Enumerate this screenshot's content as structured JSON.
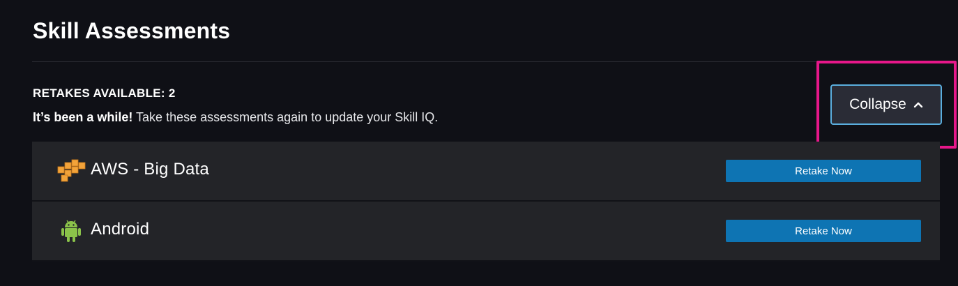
{
  "header": {
    "title": "Skill Assessments"
  },
  "retakes": {
    "heading": "RETAKES AVAILABLE: 2",
    "message_bold": "It’s been a while!",
    "message_rest": " Take these assessments again to update your Skill IQ."
  },
  "collapse": {
    "label": "Collapse",
    "icon": "chevron-up-icon"
  },
  "assessments": [
    {
      "name": "AWS - Big Data",
      "icon": "aws-icon",
      "action_label": "Retake Now"
    },
    {
      "name": "Android",
      "icon": "android-icon",
      "action_label": "Retake Now"
    }
  ],
  "colors": {
    "background": "#0f1016",
    "row_background": "#232428",
    "primary_button": "#0e74b3",
    "collapse_border": "#5aaede",
    "highlight": "#e7178a",
    "aws_orange": "#f2a33a",
    "android_green": "#8bc34a"
  }
}
